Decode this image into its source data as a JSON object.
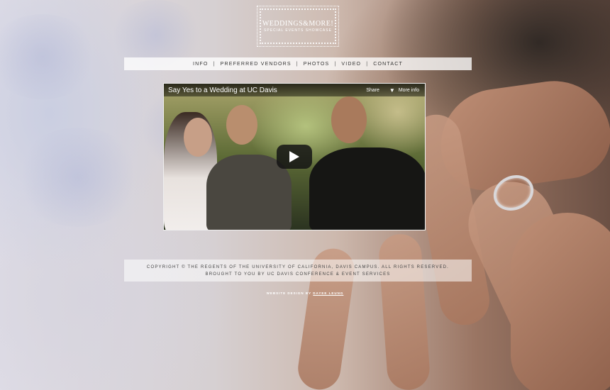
{
  "logo": {
    "title": "WEDDINGS&MORE!",
    "subtitle": "SPECIAL EVENTS SHOWCASE"
  },
  "nav": {
    "items": [
      {
        "label": "INFO"
      },
      {
        "label": "PREFERRED VENDORS"
      },
      {
        "label": "PHOTOS"
      },
      {
        "label": "VIDEO"
      },
      {
        "label": "CONTACT"
      }
    ],
    "separator": "|"
  },
  "video": {
    "title": "Say Yes to a Wedding at UC Davis",
    "share_label": "Share",
    "more_info_label": "More info",
    "more_info_icon": "down-arrow-icon",
    "play_icon": "play-icon"
  },
  "footer": {
    "copyright": "COPYRIGHT © THE REGENTS OF THE UNIVERSITY OF CALIFORNIA, DAVIS CAMPUS. ALL RIGHTS RESERVED.",
    "brought_by": "BROUGHT TO YOU BY UC DAVIS CONFERENCE & EVENT SERVICES"
  },
  "credit": {
    "prefix": "WEBSITE DESIGN BY",
    "designer": "DAYEE LEUNG"
  },
  "colors": {
    "nav_bg": "#ffffff",
    "text_dark": "#333333",
    "video_bar": "#000000",
    "play_button": "#141414"
  }
}
